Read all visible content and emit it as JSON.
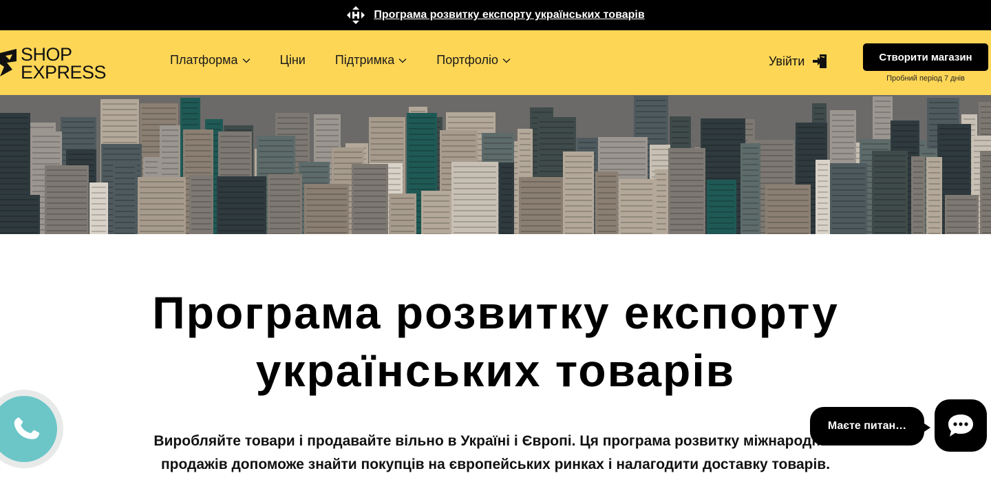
{
  "topbar": {
    "icon": "nova-poshta-logo-icon",
    "link_text": "Програма розвитку експорту українських товарів"
  },
  "header": {
    "logo": {
      "line1": "SHOP",
      "line2": "EXPRESS"
    },
    "nav": [
      {
        "label": "Платформа",
        "has_dropdown": true
      },
      {
        "label": "Ціни",
        "has_dropdown": false
      },
      {
        "label": "Підтримка",
        "has_dropdown": true
      },
      {
        "label": "Портфоліо",
        "has_dropdown": true
      }
    ],
    "login_label": "Увійти",
    "login_icon": "login-icon",
    "cta_label": "Створити магазин",
    "cta_sub": "Пробний період 7 днів"
  },
  "hero": {
    "image": "city-skyline-aerial"
  },
  "main": {
    "title_line1": "Програма розвитку експорту",
    "title_line2": "українських товарів",
    "lead_line1": "Виробляйте товари і продавайте вільно в Україні і Європі. Ця програма розвитку міжнародних",
    "lead_line2": "продажів допоможе знайти покупців на європейських ринках і налагодити доставку товарів."
  },
  "widgets": {
    "phone_icon": "phone-icon",
    "chat_text": "Маєте питан…",
    "chat_icon": "chat-icon"
  },
  "colors": {
    "brand_yellow": "#fed656",
    "black": "#000000",
    "phone_teal": "#6cc6c8"
  }
}
